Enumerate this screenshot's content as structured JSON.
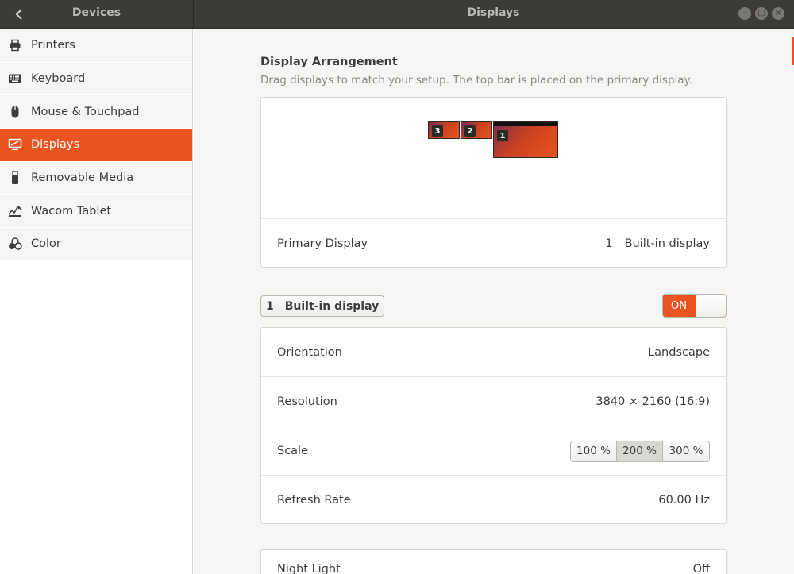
{
  "header": {
    "left_title": "Devices",
    "title": "Displays",
    "back_icon": "chevron-left-icon",
    "window_buttons": [
      "minimize-icon",
      "maximize-icon",
      "close-icon"
    ]
  },
  "sidebar": {
    "items": [
      {
        "label": "Printers",
        "icon": "printer-icon"
      },
      {
        "label": "Keyboard",
        "icon": "keyboard-icon"
      },
      {
        "label": "Mouse & Touchpad",
        "icon": "mouse-icon"
      },
      {
        "label": "Displays",
        "icon": "display-icon",
        "active": true
      },
      {
        "label": "Removable Media",
        "icon": "usb-icon"
      },
      {
        "label": "Wacom Tablet",
        "icon": "tablet-icon"
      },
      {
        "label": "Color",
        "icon": "color-icon"
      }
    ]
  },
  "arrangement": {
    "title": "Display Arrangement",
    "subtitle": "Drag displays to match your setup. The top bar is placed on the primary display.",
    "monitors": [
      {
        "number": "3"
      },
      {
        "number": "2"
      },
      {
        "number": "1",
        "primary": true
      }
    ],
    "primary_label": "Primary Display",
    "primary_number": "1",
    "primary_value": "Built-in display"
  },
  "display": {
    "number": "1",
    "name": "Built-in display",
    "switch_label": "ON",
    "switch_on": true
  },
  "settings": {
    "orientation_label": "Orientation",
    "orientation_value": "Landscape",
    "resolution_label": "Resolution",
    "resolution_value": "3840 × 2160 (16:9)",
    "scale_label": "Scale",
    "scale_options": [
      "100 %",
      "200 %",
      "300 %"
    ],
    "scale_selected": "200 %",
    "refresh_label": "Refresh Rate",
    "refresh_value": "60.00 Hz"
  },
  "night_light": {
    "label": "Night Light",
    "value": "Off"
  },
  "colors": {
    "accent": "#e95420",
    "header_bg": "#3d3b37"
  }
}
